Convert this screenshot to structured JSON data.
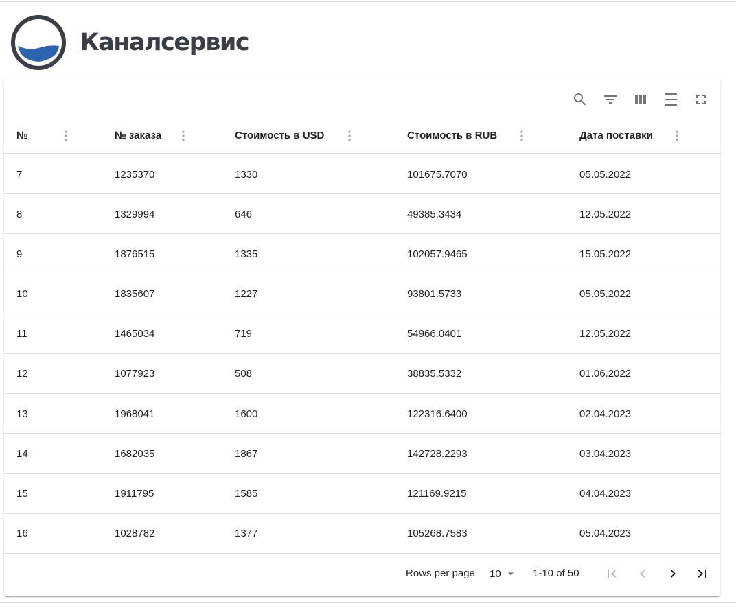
{
  "brand": {
    "name": "Каналсервис",
    "logo_icon": "water-circle-logo-icon",
    "colors": {
      "ring": "#3a3f45",
      "water": "#2e63b0"
    }
  },
  "toolbar": {
    "icons": [
      "search-icon",
      "filter-icon",
      "columns-icon",
      "density-icon",
      "fullscreen-icon"
    ]
  },
  "table": {
    "columns": [
      "№",
      "№ заказа",
      "Стоимость в USD",
      "Стоимость в RUB",
      "Дата поставки"
    ],
    "rows": [
      [
        "7",
        "1235370",
        "1330",
        "101675.7070",
        "05.05.2022"
      ],
      [
        "8",
        "1329994",
        "646",
        "49385.3434",
        "12.05.2022"
      ],
      [
        "9",
        "1876515",
        "1335",
        "102057.9465",
        "15.05.2022"
      ],
      [
        "10",
        "1835607",
        "1227",
        "93801.5733",
        "05.05.2022"
      ],
      [
        "11",
        "1465034",
        "719",
        "54966.0401",
        "12.05.2022"
      ],
      [
        "12",
        "1077923",
        "508",
        "38835.5332",
        "01.06.2022"
      ],
      [
        "13",
        "1968041",
        "1600",
        "122316.6400",
        "02.04.2023"
      ],
      [
        "14",
        "1682035",
        "1867",
        "142728.2293",
        "03.04.2023"
      ],
      [
        "15",
        "1911795",
        "1585",
        "121169.9215",
        "04.04.2023"
      ],
      [
        "16",
        "1028782",
        "1377",
        "105268.7583",
        "05.04.2023"
      ]
    ]
  },
  "pagination": {
    "rows_per_page_label": "Rows per page",
    "rows_per_page_value": "10",
    "range_label": "1-10 of 50",
    "buttons": {
      "first": "first-page-icon",
      "prev": "chevron-left-icon",
      "next": "chevron-right-icon",
      "last": "last-page-icon"
    }
  }
}
